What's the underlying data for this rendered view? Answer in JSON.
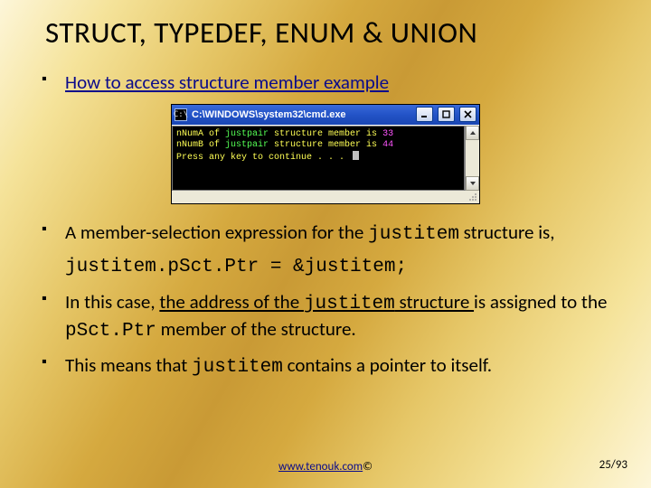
{
  "heading": "STRUCT, TYPEDEF, ENUM & UNION",
  "bullet1_link": "How to access structure member example",
  "cmd": {
    "title": "C:\\WINDOWS\\system32\\cmd.exe",
    "icon_text": "C:\\",
    "line1": {
      "a": "nNumA of ",
      "b": "justpair",
      "c": " structure member is ",
      "d": "33"
    },
    "line2": {
      "a": "nNumB of ",
      "b": "justpair",
      "c": " structure member is ",
      "d": "44"
    },
    "line3": "Press any key to continue . . . "
  },
  "bullet2": {
    "pre": "A member-selection expression for the ",
    "code": "justitem",
    "post": " structure is,"
  },
  "code_line": "justitem.pSct.Ptr = &justitem;",
  "bullet3": {
    "t1": "In this case, ",
    "u1": "the address of the ",
    "c1": "justitem",
    "u2": " structure ",
    "t2": "is assigned to the ",
    "c2": "pSct.Ptr",
    "t3": " member of the structure."
  },
  "bullet4": {
    "t1": "This means that ",
    "c1": "justitem",
    "t2": " contains a pointer to itself."
  },
  "footer": {
    "link": "www.tenouk.com",
    "copy": " ©"
  },
  "page": "25/93"
}
